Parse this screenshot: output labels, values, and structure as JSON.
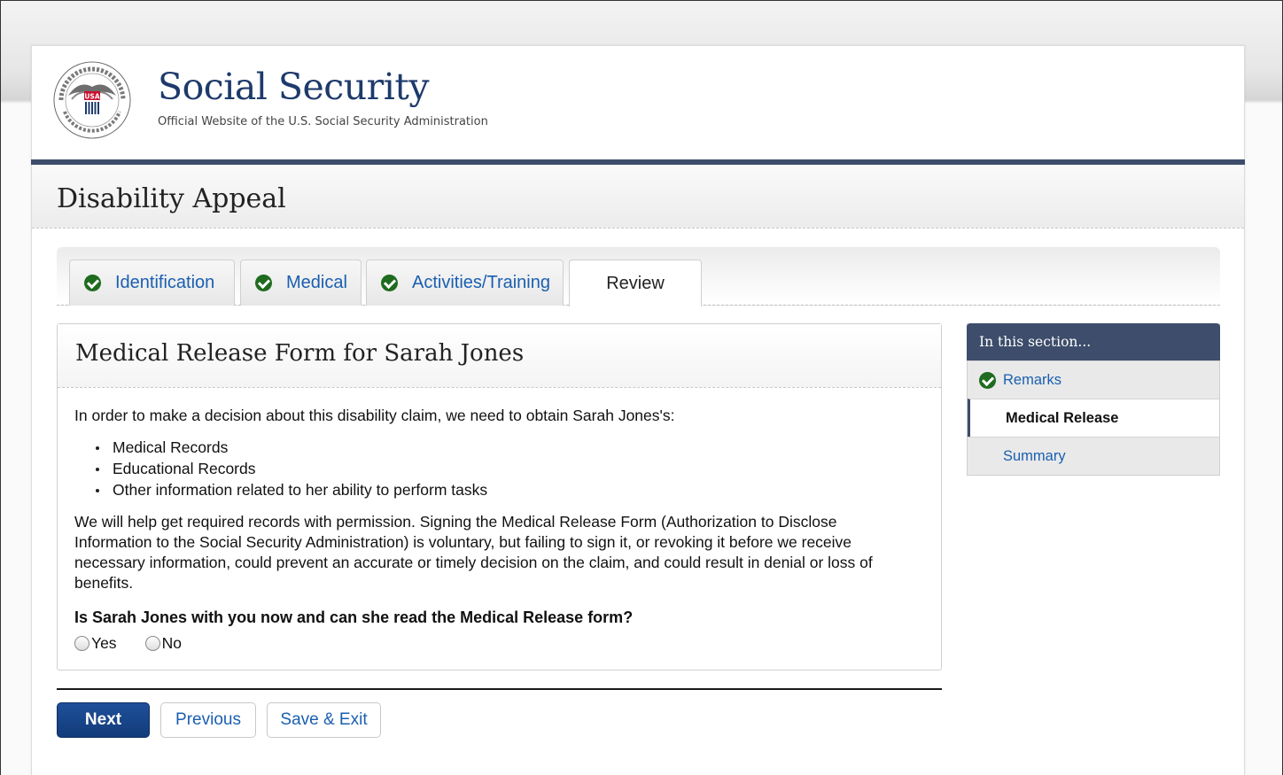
{
  "header": {
    "title": "Social Security",
    "subtitle": "Official Website of the U.S. Social Security Administration",
    "seal_text": "USA"
  },
  "page_title": "Disability Appeal",
  "tabs": [
    {
      "label": "Identification",
      "complete": true
    },
    {
      "label": "Medical",
      "complete": true
    },
    {
      "label": "Activities/Training",
      "complete": true
    },
    {
      "label": "Review",
      "complete": false,
      "active": true
    }
  ],
  "panel": {
    "title": "Medical Release Form for Sarah Jones",
    "intro": "In order to make a decision about this disability claim, we need to obtain Sarah Jones's:",
    "bullets": [
      "Medical Records",
      "Educational Records",
      "Other information related to her ability to perform tasks"
    ],
    "paragraph": "We will help get required records with permission. Signing the Medical Release Form (Authorization to Disclose Information to the Social Security Administration) is voluntary, but failing to sign it, or revoking it before we receive necessary information, could prevent an accurate or timely decision on the claim, and could result in denial or loss of benefits.",
    "question": "Is Sarah Jones with you now and can she read the Medical Release form?",
    "options": [
      "Yes",
      "No"
    ]
  },
  "sidebar": {
    "heading": "In this section...",
    "items": [
      {
        "label": "Remarks",
        "state": "complete"
      },
      {
        "label": "Medical Release",
        "state": "current"
      },
      {
        "label": "Summary",
        "state": "pending"
      }
    ]
  },
  "buttons": {
    "next": "Next",
    "previous": "Previous",
    "save_exit": "Save & Exit"
  },
  "colors": {
    "brand_navy": "#3d4d6b",
    "link_blue": "#1a5fb0",
    "check_green": "#1f6b1f",
    "primary_button": "#1a4a8f"
  }
}
